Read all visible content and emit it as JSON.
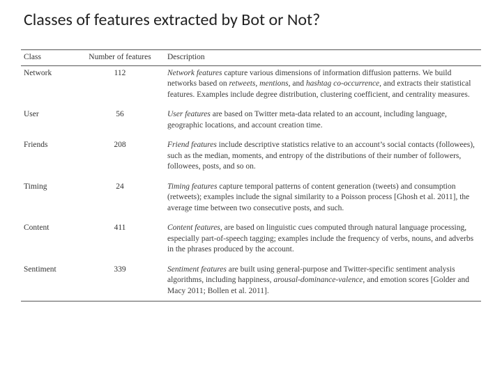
{
  "title": "Classes of features extracted by Bot or Not?",
  "table": {
    "headers": {
      "class": "Class",
      "num": "Number of features",
      "desc": "Description"
    },
    "rows": [
      {
        "class": "Network",
        "num": "112",
        "desc_html": "<em>Network features</em> capture various dimensions of information diffusion patterns. We build networks based on <em>retweets</em>, <em>mentions</em>, and <em>hashtag co-occurrence</em>, and extracts their statistical features. Examples include degree distribution, clustering coefficient, and centrality measures."
      },
      {
        "class": "User",
        "num": "56",
        "desc_html": "<em>User features</em> are based on Twitter meta-data related to an account, including language, geographic locations, and account creation time."
      },
      {
        "class": "Friends",
        "num": "208",
        "desc_html": "<em>Friend features</em> include descriptive statistics relative to an account’s social contacts (followees), such as the median, moments, and entropy of the distributions of their number of followers, followees, posts, and so on."
      },
      {
        "class": "Timing",
        "num": "24",
        "desc_html": "<em>Timing features</em> capture temporal patterns of content generation (tweets) and consumption (retweets); examples include the signal similarity to a Poisson process [Ghosh et al. 2011], the average time between two consecutive posts, and such."
      },
      {
        "class": "Content",
        "num": "411",
        "desc_html": "<em>Content features</em>, are based on linguistic cues computed through natural language processing, especially part-of-speech tagging; examples include the frequency of verbs, nouns, and adverbs in the phrases produced by the account."
      },
      {
        "class": "Sentiment",
        "num": "339",
        "desc_html": "<em>Sentiment features</em> are built using general-purpose and Twitter-specific sentiment analysis algorithms, including happiness, <em>arousal-dominance-valence</em>, and emotion scores [Golder and Macy 2011; Bollen et al. 2011]."
      }
    ]
  }
}
